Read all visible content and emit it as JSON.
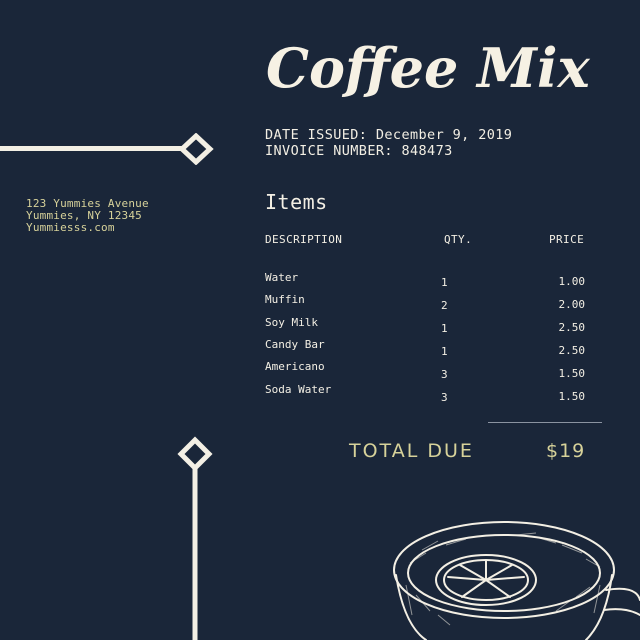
{
  "header": {
    "title": "Coffee Mix"
  },
  "invoice": {
    "date_label": "DATE ISSUED:",
    "date_value": "December 9, 2019",
    "number_label": "INVOICE NUMBER:",
    "number_value": "848473"
  },
  "address": {
    "line1": "123 Yummies Avenue",
    "line2": "Yummies, NY 12345",
    "line3": "Yummiesss.com"
  },
  "items": {
    "heading": "Items",
    "columns": {
      "description": "DESCRIPTION",
      "qty": "QTY.",
      "price": "PRICE"
    },
    "rows": [
      {
        "description": "Water",
        "qty": "1",
        "price": "1.00"
      },
      {
        "description": "Muffin",
        "qty": "2",
        "price": "2.00"
      },
      {
        "description": "Soy Milk",
        "qty": "1",
        "price": "2.50"
      },
      {
        "description": "Candy Bar",
        "qty": "1",
        "price": "2.50"
      },
      {
        "description": "Americano",
        "qty": "3",
        "price": "1.50"
      },
      {
        "description": "Soda Water",
        "qty": "3",
        "price": "1.50"
      }
    ]
  },
  "total": {
    "label": "TOTAL DUE",
    "value": "$19"
  },
  "colors": {
    "background": "#1a2639",
    "text": "#f3efe4",
    "accent": "#d7d29a"
  },
  "icons": [
    "diamond-arrow-icon",
    "coffee-cup-illustration"
  ]
}
